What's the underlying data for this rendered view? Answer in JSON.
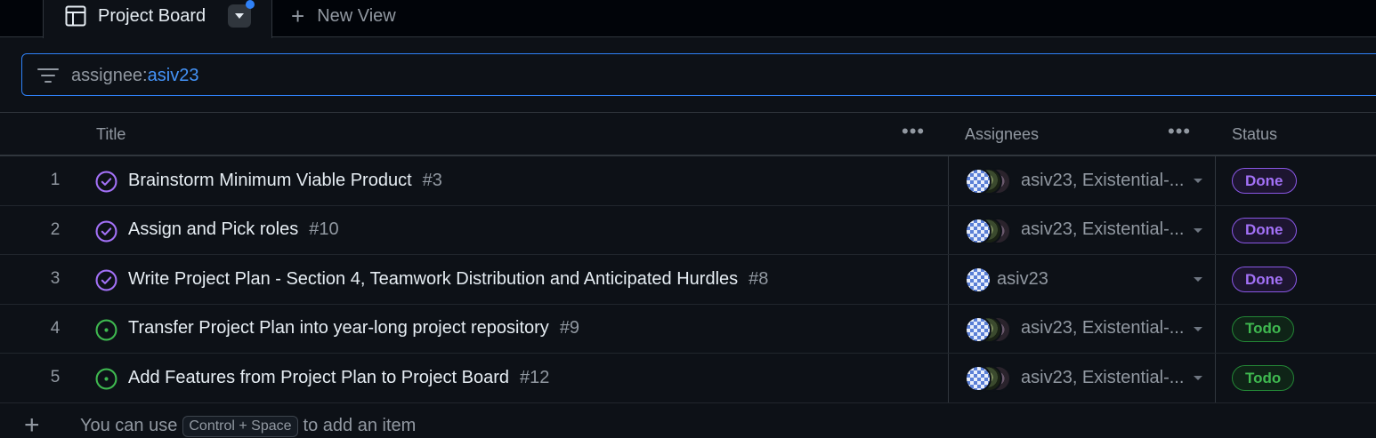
{
  "tabs": {
    "active_label": "Project Board",
    "new_view_label": "New View"
  },
  "filter": {
    "key": "assignee:",
    "value": "asiv23"
  },
  "columns": {
    "title": "Title",
    "assignees": "Assignees",
    "status": "Status"
  },
  "rows": [
    {
      "num": "1",
      "title": "Brainstorm Minimum Viable Product",
      "issue": "#3",
      "assignees": "asiv23, Existential-...",
      "status": "Done",
      "state": "closed"
    },
    {
      "num": "2",
      "title": "Assign and Pick roles",
      "issue": "#10",
      "assignees": "asiv23, Existential-...",
      "status": "Done",
      "state": "closed"
    },
    {
      "num": "3",
      "title": "Write Project Plan - Section 4, Teamwork Distribution and Anticipated Hurdles",
      "issue": "#8",
      "assignees": "asiv23",
      "status": "Done",
      "state": "closed"
    },
    {
      "num": "4",
      "title": "Transfer Project Plan into year-long project repository",
      "issue": "#9",
      "assignees": "asiv23, Existential-...",
      "status": "Todo",
      "state": "open"
    },
    {
      "num": "5",
      "title": "Add Features from Project Plan to Project Board",
      "issue": "#12",
      "assignees": "asiv23, Existential-...",
      "status": "Todo",
      "state": "open"
    }
  ],
  "add_item": {
    "hint_before": "You can use",
    "shortcut": "Control + Space",
    "hint_after": "to add an item"
  },
  "colors": {
    "background": "#0d1117",
    "accent": "#2f81f7",
    "done": "#a371f7",
    "todo": "#3fb950"
  },
  "icons": [
    "table-icon",
    "chevron-down-icon",
    "plus-icon",
    "filter-icon",
    "kebab-icon",
    "closed-issue-icon",
    "open-issue-icon",
    "avatar"
  ]
}
